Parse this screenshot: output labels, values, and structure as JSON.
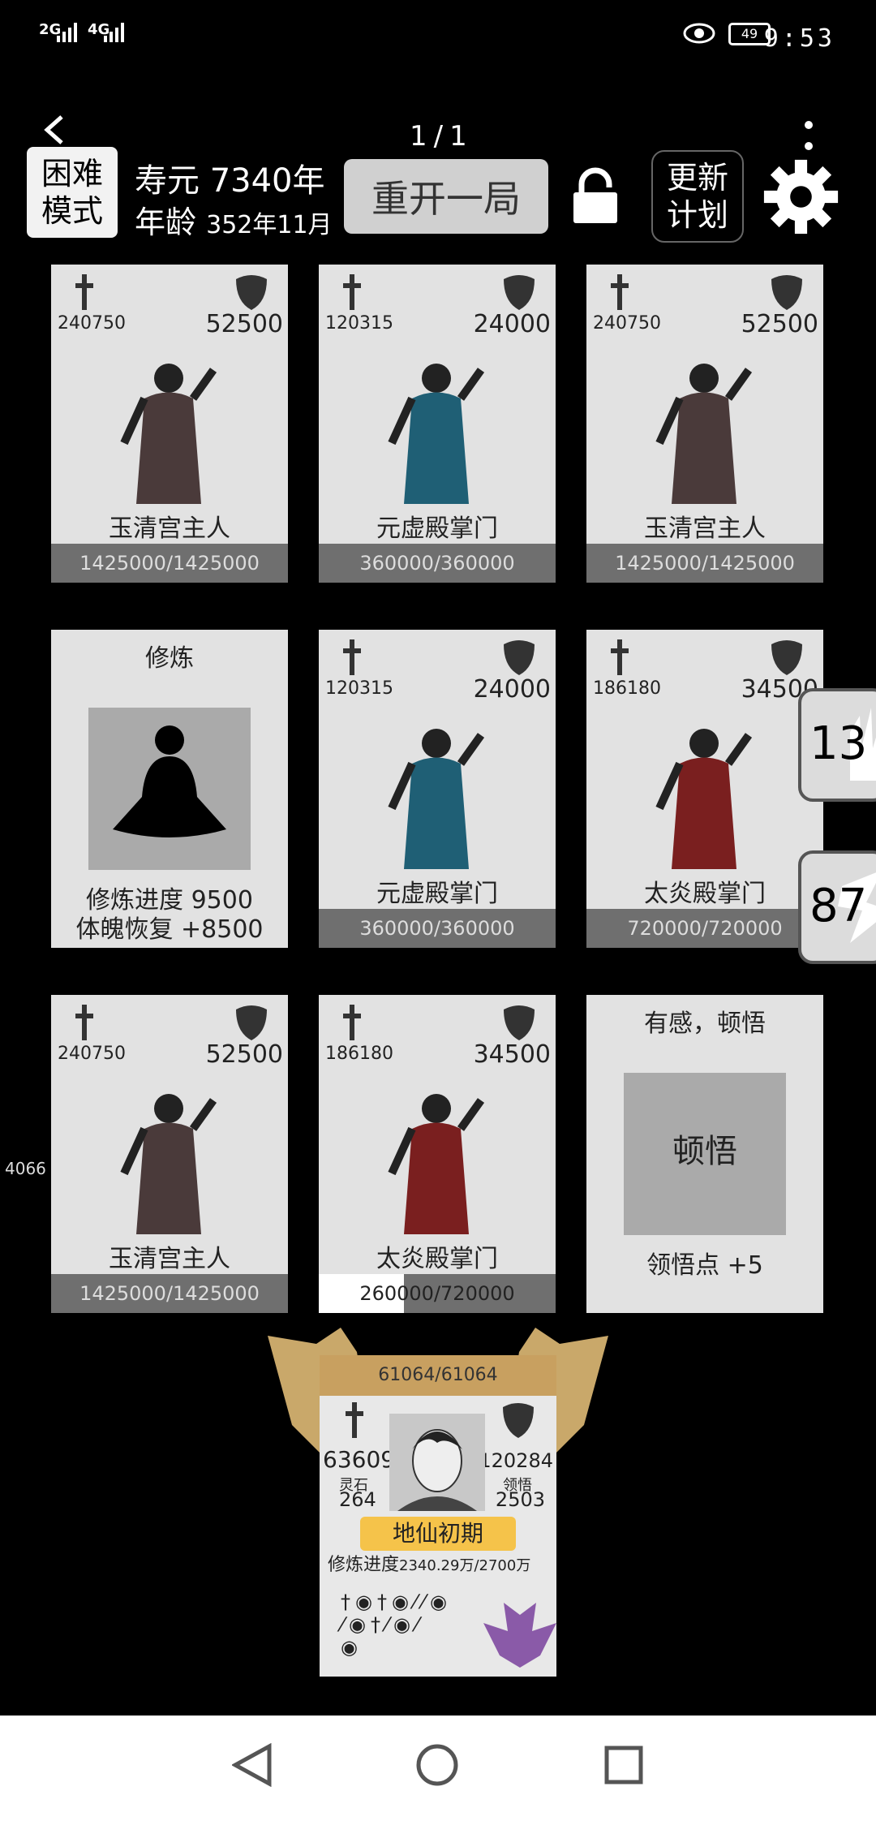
{
  "status": {
    "signal1": "2G",
    "signal2": "4G",
    "battery": "49",
    "time": "9:53"
  },
  "header": {
    "mode": "困难模式",
    "lifespan": "寿元 7340年",
    "age_label": "年龄",
    "age_value": "352年11月",
    "restart": "重开一局",
    "counter": "1/1",
    "update": "更新计划"
  },
  "cards": [
    {
      "atk": "240750",
      "def": "52500",
      "name": "玉清宫主人",
      "hp": "1425000/1425000",
      "hp_frac": 1
    },
    {
      "atk": "120315",
      "def": "24000",
      "name": "元虚殿掌门",
      "hp": "360000/360000",
      "hp_frac": 1
    },
    {
      "atk": "240750",
      "def": "52500",
      "name": "玉清宫主人",
      "hp": "1425000/1425000",
      "hp_frac": 1
    },
    {
      "title": "修炼",
      "line1": "修炼进度  9500",
      "line2": "体魄恢复  +8500"
    },
    {
      "atk": "120315",
      "def": "24000",
      "name": "元虚殿掌门",
      "hp": "360000/360000",
      "hp_frac": 1
    },
    {
      "atk": "186180",
      "def": "34500",
      "name": "太炎殿掌门",
      "hp": "720000/720000",
      "hp_frac": 1
    },
    {
      "atk": "240750",
      "def": "52500",
      "name": "玉清宫主人",
      "hp": "1425000/1425000",
      "hp_frac": 1
    },
    {
      "atk": "186180",
      "def": "34500",
      "name": "太炎殿掌门",
      "hp": "260000/720000",
      "hp_frac": 0.361
    },
    {
      "title": "有感，顿悟",
      "line1": "领悟点  +5"
    }
  ],
  "side_tabs": {
    "hand": "13",
    "energy": "87"
  },
  "left_number": "4066",
  "player": {
    "hp": "61064/61064",
    "atk": "63609",
    "def": "120284",
    "stone_label": "灵石",
    "stone_value": "264",
    "insight_label": "领悟",
    "insight_value": "2503",
    "realm": "地仙初期",
    "progress_label": "修炼进度",
    "progress_value": "2340.29万/2700万"
  },
  "icons": {
    "back": "chevron-left-icon",
    "lock": "lock-icon",
    "settings": "gear-icon"
  }
}
